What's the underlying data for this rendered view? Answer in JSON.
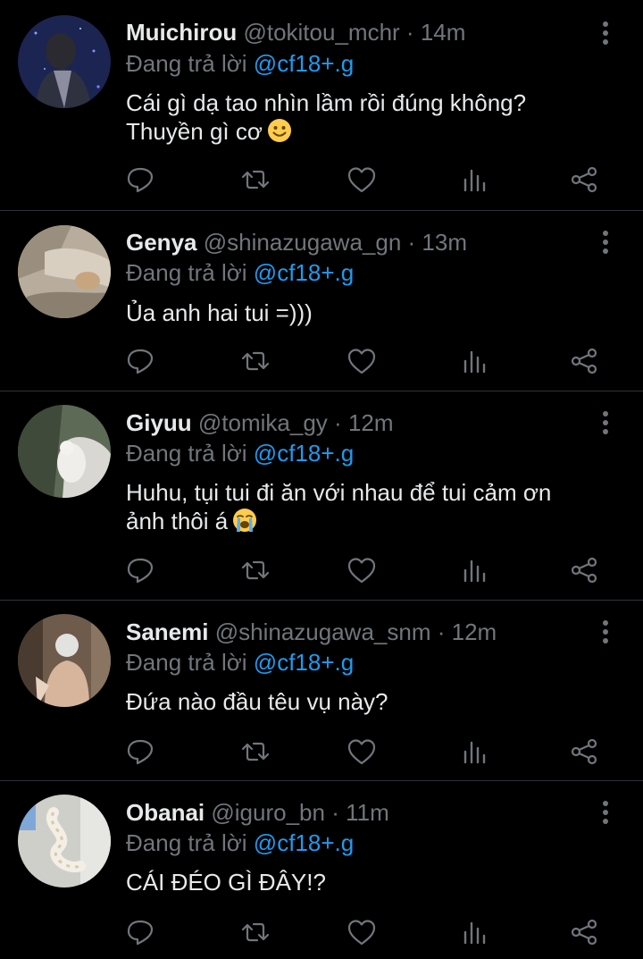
{
  "colors": {
    "background": "#000000",
    "text": "#e7e9ea",
    "muted": "#71767b",
    "link": "#1d9bf0",
    "divider": "#2f3336"
  },
  "reply_prefix": "Đang trả lời",
  "tweets": [
    {
      "name": "Muichirou",
      "handle": "@tokitou_mchr",
      "dot": "·",
      "time": "14m",
      "mention": "@cf18+.g",
      "text_lines": [
        "Cái gì dạ tao nhìn lầm rồi đúng không?",
        "Thuyền gì cơ"
      ],
      "emoji": "smiling-face-emoji"
    },
    {
      "name": "Genya",
      "handle": "@shinazugawa_gn",
      "dot": "·",
      "time": "13m",
      "mention": "@cf18+.g",
      "text_lines": [
        "Ủa anh hai tui =)))"
      ],
      "emoji": ""
    },
    {
      "name": "Giyuu",
      "handle": "@tomika_gy",
      "dot": "·",
      "time": "12m",
      "mention": "@cf18+.g",
      "text_lines": [
        "Huhu, tụi tui đi ăn với nhau để tui cảm ơn",
        "ảnh thôi á"
      ],
      "emoji": "loudly-crying-face-emoji"
    },
    {
      "name": "Sanemi",
      "handle": "@shinazugawa_snm",
      "dot": "·",
      "time": "12m",
      "mention": "@cf18+.g",
      "text_lines": [
        "Đứa nào đầu têu vụ này?"
      ],
      "emoji": ""
    },
    {
      "name": "Obanai",
      "handle": "@iguro_bn",
      "dot": "·",
      "time": "11m",
      "mention": "@cf18+.g",
      "text_lines": [
        "CÁI ĐÉO GÌ ĐÂY!?"
      ],
      "emoji": ""
    }
  ],
  "action_icons": [
    "reply-icon",
    "retweet-icon",
    "like-icon",
    "views-icon",
    "share-icon"
  ]
}
